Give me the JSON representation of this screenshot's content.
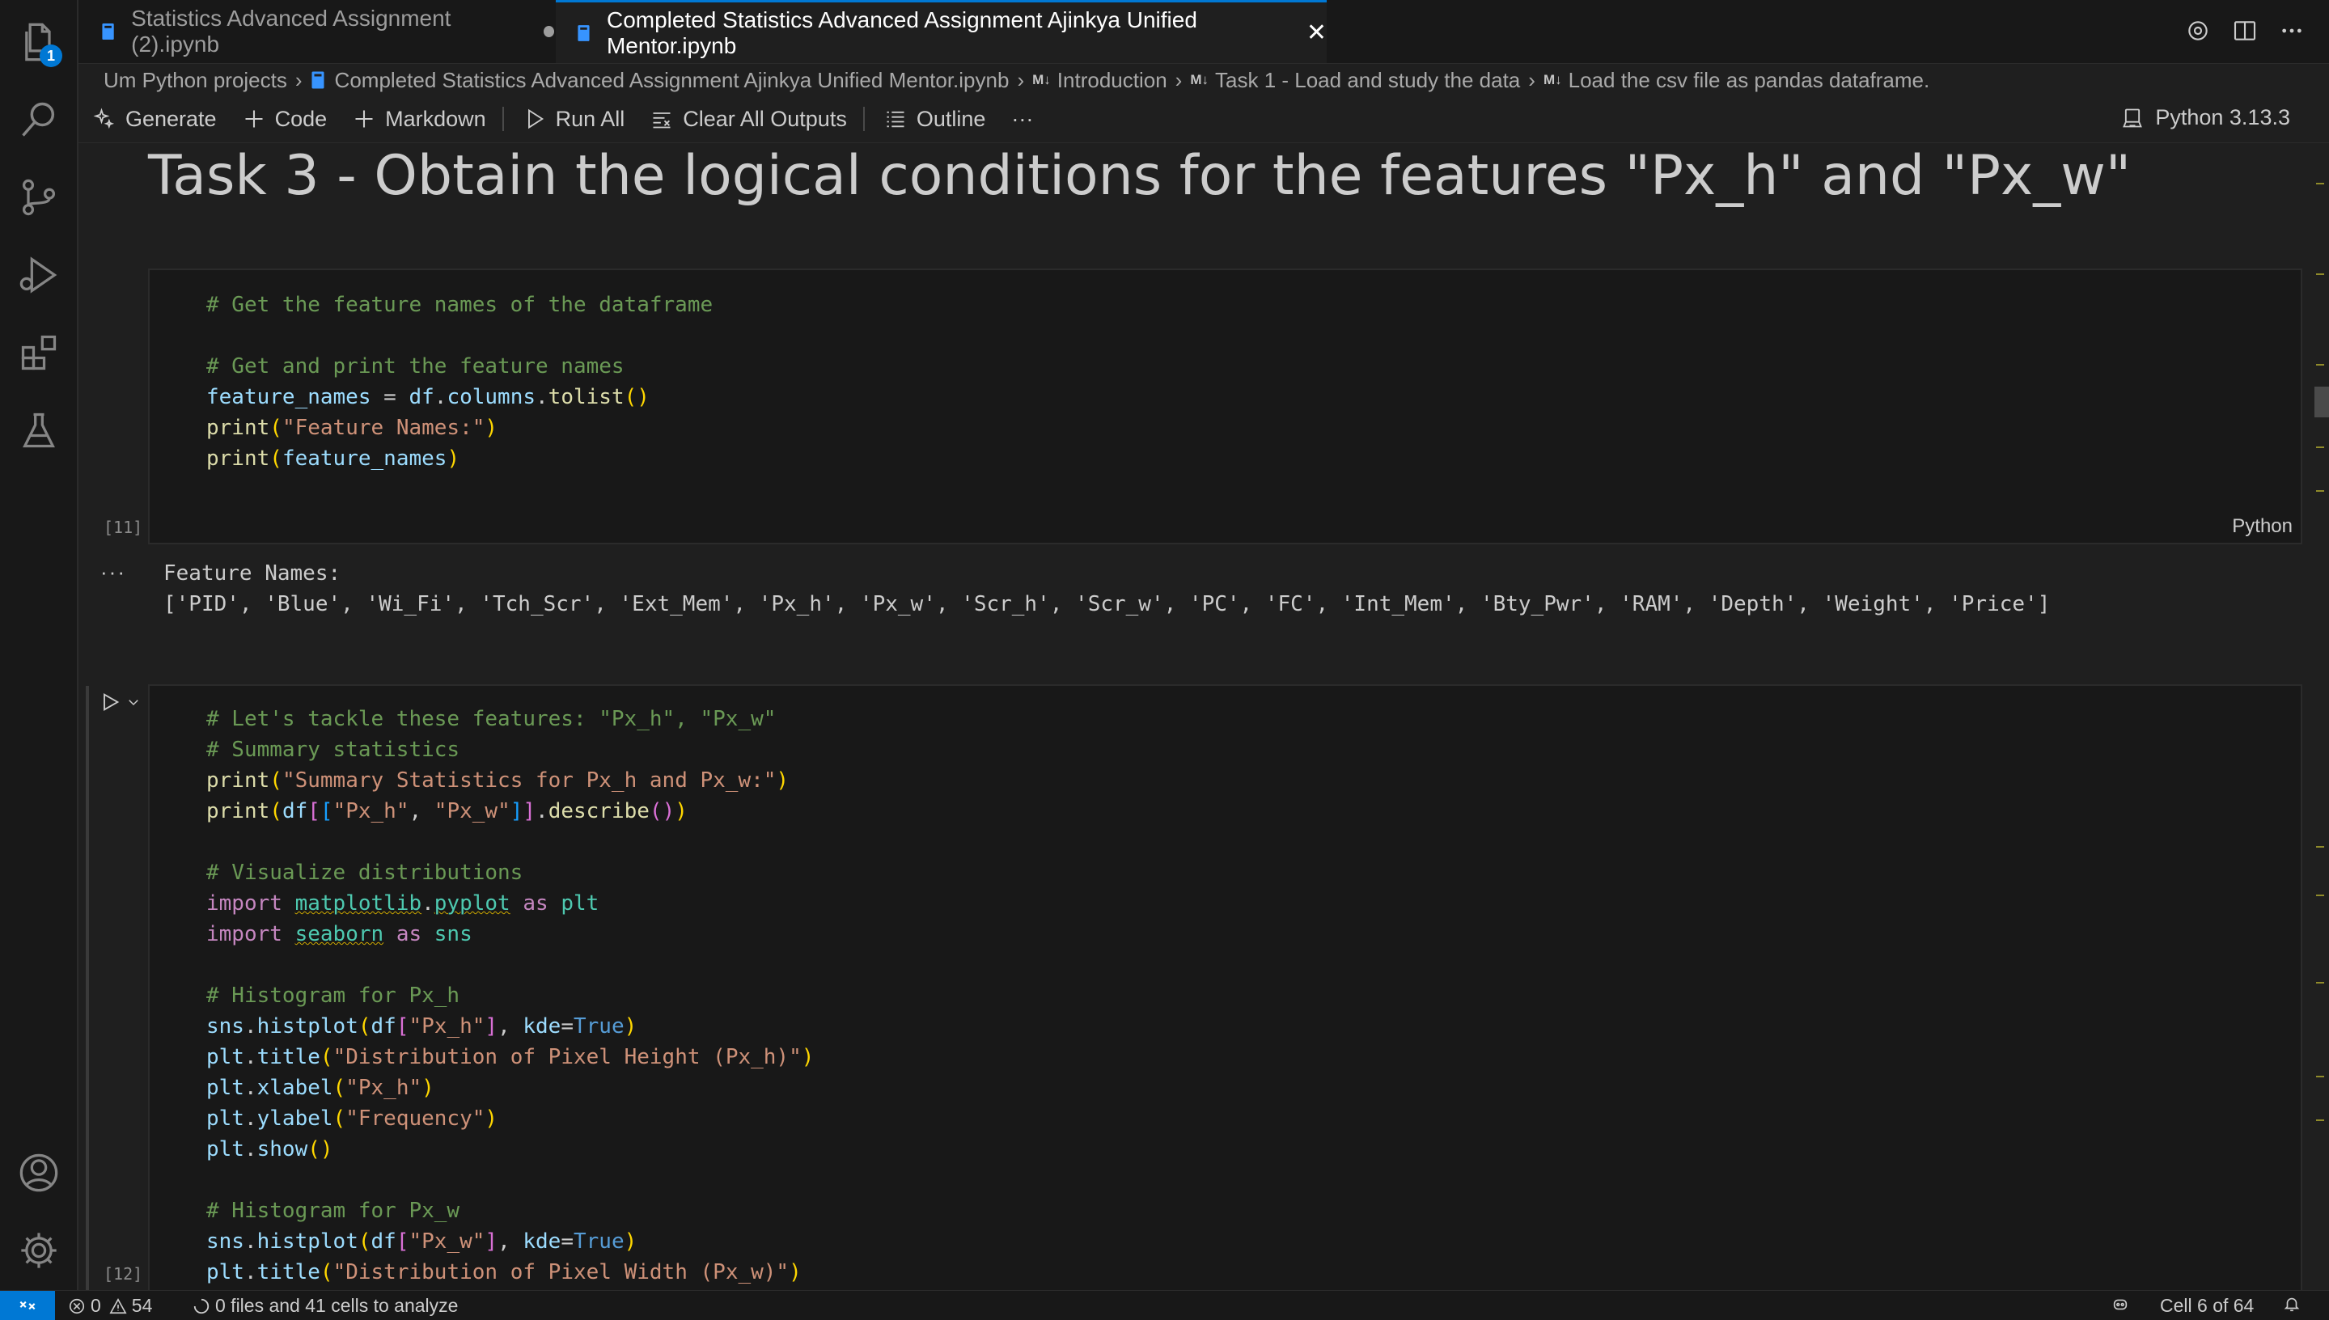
{
  "activity_bar": {
    "explorer_badge": "1",
    "icons": [
      "files-icon",
      "search-icon",
      "source-control-icon",
      "run-debug-icon",
      "extensions-icon",
      "testing-icon",
      "account-icon",
      "settings-gear-icon"
    ]
  },
  "tabs": [
    {
      "label": "Statistics Advanced Assignment (2).ipynb",
      "dirty": true
    },
    {
      "label": "Completed Statistics Advanced Assignment Ajinkya Unified Mentor.ipynb",
      "active": true
    }
  ],
  "breadcrumb": {
    "folder": "Um Python projects",
    "file": "Completed Statistics Advanced Assignment Ajinkya Unified Mentor.ipynb",
    "md_badge": "M↓",
    "section1": "Introduction",
    "section2": "Task 1 - Load and study the data",
    "section3": "Load the csv file as pandas dataframe."
  },
  "toolbar": {
    "generate": "Generate",
    "code": "Code",
    "markdown": "Markdown",
    "run_all": "Run All",
    "clear_outputs": "Clear All Outputs",
    "outline": "Outline",
    "more": "···",
    "kernel": "Python 3.13.3"
  },
  "heading": "Task 3 - Obtain the logical conditions for the features \"Px_h\" and \"Px_w\"",
  "cell11": {
    "exec_count": "[11]",
    "language": "Python",
    "output_more": "···",
    "output_line1": "Feature Names:",
    "output_line2": "['PID', 'Blue', 'Wi_Fi', 'Tch_Scr', 'Ext_Mem', 'Px_h', 'Px_w', 'Scr_h', 'Scr_w', 'PC', 'FC', 'Int_Mem', 'Bty_Pwr', 'RAM', 'Depth', 'Weight', 'Price']"
  },
  "cell12": {
    "exec_count": "[12]"
  },
  "statusbar": {
    "errors": "0",
    "warnings": "54",
    "analysis": "0 files and 41 cells to analyze",
    "cell_position": "Cell 6 of 64"
  },
  "colors": {
    "accent": "#0078d4",
    "editor_bg": "#1f1f1f",
    "cell_bg": "#181818",
    "comment": "#6a9955",
    "string": "#ce9178",
    "keyword": "#c586c0"
  }
}
